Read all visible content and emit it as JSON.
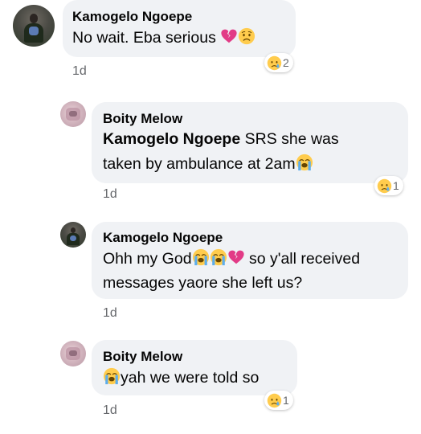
{
  "comments": [
    {
      "author": "Kamogelo Ngoepe",
      "text": "No wait. Eba serious",
      "emojis": [
        "broken-heart",
        "worried-face"
      ],
      "reaction": {
        "emoji": "sad-tear-face",
        "count": "2"
      },
      "time": "1d"
    },
    {
      "author": "Boity Melow",
      "mention": "Kamogelo Ngoepe",
      "text_line1": " SRS she was",
      "text_line2": "taken by ambulance at 2am",
      "emojis": [
        "loudly-crying-face"
      ],
      "reaction": {
        "emoji": "sad-tear-face",
        "count": "1"
      },
      "time": "1d"
    },
    {
      "author": "Kamogelo Ngoepe",
      "text_line1_a": "Ohh my God",
      "text_line1_b": " so y'all received",
      "text_line2": "messages yaore she left us?",
      "emojis": [
        "loudly-crying-face",
        "loudly-crying-face",
        "broken-heart"
      ],
      "time": "1d"
    },
    {
      "author": "Boity Melow",
      "text": "yah we were told so",
      "emojis": [
        "loudly-crying-face"
      ],
      "reaction": {
        "emoji": "sad-tear-face",
        "count": "1"
      },
      "time": "1d"
    }
  ],
  "colors": {
    "bubble": "#f0f2f5",
    "timestamp": "#65676b",
    "emoji_yellow": "#ffcc4d",
    "broken_heart": "#e23b86"
  }
}
